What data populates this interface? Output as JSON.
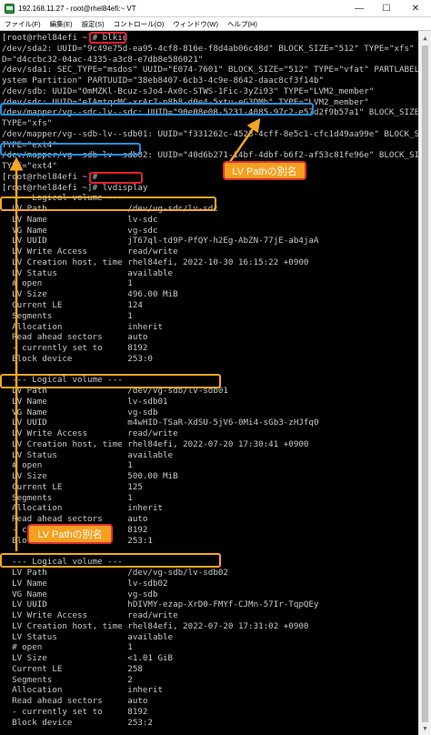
{
  "window": {
    "title": "192.168.11.27 - root@rhel84efi:~ VT",
    "min_glyph": "—",
    "max_glyph": "☐",
    "close_glyph": "✕"
  },
  "menu": [
    "ファイル(F)",
    "編集(E)",
    "設定(S)",
    "コントロール(O)",
    "ウィンドウ(W)",
    "ヘルプ(H)"
  ],
  "terminal": {
    "lines": [
      "[root@rhel84efi ~]# blkid",
      "/dev/sda2: UUID=\"9c49e75d-ea95-4cf8-816e-f8d4ab06c48d\" BLOCK_SIZE=\"512\" TYPE=\"xfs\" PARTUUI",
      "D=\"d4ccbc32-04ac-4335-a3c8-e7db8e586021\"",
      "/dev/sda1: SEC_TYPE=\"msdos\" UUID=\"E074-7601\" BLOCK_SIZE=\"512\" TYPE=\"vfat\" PARTLABEL=\"EFI S",
      "ystem Partition\" PARTUUID=\"38eb8407-6cb3-4c9e-8642-daac8cf3f14b\"",
      "/dev/sdb: UUID=\"OmMZKl-Bcuz-sJo4-Ax0c-STWS-1Fic-3yZi93\" TYPE=\"LVM2_member\"",
      "/dev/sdc: UUID=\"eIAmtqrMC-xrAr7-n8h8-d0e4-5xtu-eG3DMb\" TYPE=\"LVM2_member\"",
      "/dev/mapper/vg--sdc-lv--sdc: UUID=\"90e08e08-5231-4085-97c2-e57d2f9b57a1\" BLOCK_SIZE=\"512\"",
      "TYPE=\"xfs\"",
      "/dev/mapper/vg--sdb-lv--sdb01: UUID=\"f331262c-4523-4cff-8e5c1-cfc1d49aa99e\" BLOCK_SIZE=\"512\"",
      "TYPE=\"ext4\"",
      "/dev/mapper/vg--sdb-lv--sdb02: UUID=\"40d6b271-14bf-4dbf-b6f2-af53c81fe96e\" BLOCK_SIZE=\"102",
      "TYPE=\"ext4\"",
      "[root@rhel84efi ~]#",
      "[root@rhel84efi ~]# lvdisplay",
      "  --- Logical volume ---",
      "  LV Path                /dev/vg-sdc/lv-sdc",
      "  LV Name                lv-sdc",
      "  VG Name                vg-sdc",
      "  LV UUID                jT67ql-td9P-PfQY-h2Eg-AbZN-77jE-ab4jaA",
      "  LV Write Access        read/write",
      "  LV Creation host, time rhel84efi, 2022-10-30 16:15:22 +0900",
      "  LV Status              available",
      "  # open                 1",
      "  LV Size                496.00 MiB",
      "  Current LE             124",
      "  Segments               1",
      "  Allocation             inherit",
      "  Read ahead sectors     auto",
      "  - currently set to     8192",
      "  Block device           253:0",
      "",
      "  --- Logical volume ---",
      "  LV Path                /dev/vg-sdb/lv-sdb01",
      "  LV Name                lv-sdb01",
      "  VG Name                vg-sdb",
      "  LV UUID                m4wHID-TSaR-XdSU-5jV6-0Mi4-sGb3-zHJfq0",
      "  LV Write Access        read/write",
      "  LV Creation host, time rhel84efi, 2022-07-20 17:30:41 +0900",
      "  LV Status              available",
      "  # open                 1",
      "  LV Size                500.00 MiB",
      "  Current LE             125",
      "  Segments               1",
      "  Allocation             inherit",
      "  Read ahead sectors     auto",
      "  - currently set to     8192",
      "  Block device           253:1",
      "",
      "  --- Logical volume ---",
      "  LV Path                /dev/vg-sdb/lv-sdb02",
      "  LV Name                lv-sdb02",
      "  VG Name                vg-sdb",
      "  LV UUID                hDIVMY-ezap-XrD0-FMYf-CJMn-57Ir-TqpQEy",
      "  LV Write Access        read/write",
      "  LV Creation host, time rhel84efi, 2022-07-20 17:31:02 +0900",
      "  LV Status              available",
      "  # open                 1",
      "  LV Size                <1.01 GiB",
      "  Current LE             258",
      "  Segments               2",
      "  Allocation             inherit",
      "  Read ahead sectors     auto",
      "  - currently set to     8192",
      "  Block device           253:2",
      "",
      "[root@rhel84efi ~]# "
    ]
  },
  "annotations": {
    "callout_top": "LV Pathの別名",
    "callout_bottom": "LV Pathの別名"
  },
  "colors": {
    "terminal_bg": "#000000",
    "terminal_fg": "#c8c8c8",
    "highlight_red": "#e0202a",
    "highlight_blue": "#1e8fe0",
    "highlight_orange": "#f5a623",
    "callout_fill": "#f5a01e"
  }
}
